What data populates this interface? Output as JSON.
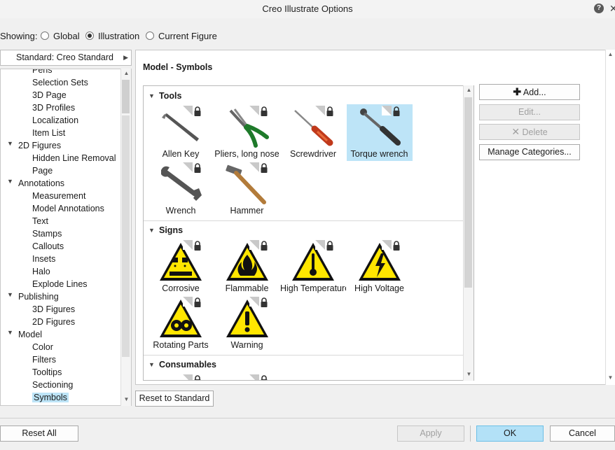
{
  "window": {
    "title": "Creo Illustrate Options"
  },
  "showing": {
    "label": "Showing:",
    "options": [
      {
        "label": "Global",
        "checked": false
      },
      {
        "label": "Illustration",
        "checked": true
      },
      {
        "label": "Current Figure",
        "checked": false
      }
    ]
  },
  "left_panel": {
    "dropdown": "Standard: Creo Standard",
    "tree": [
      {
        "label": "Pens",
        "level": 1
      },
      {
        "label": "Selection Sets",
        "level": 1
      },
      {
        "label": "3D Page",
        "level": 1
      },
      {
        "label": "3D Profiles",
        "level": 1
      },
      {
        "label": "Localization",
        "level": 1
      },
      {
        "label": "Item List",
        "level": 1
      },
      {
        "label": "2D Figures",
        "level": 0
      },
      {
        "label": "Hidden Line Removal",
        "level": 1
      },
      {
        "label": "Page",
        "level": 1
      },
      {
        "label": "Annotations",
        "level": 0
      },
      {
        "label": "Measurement",
        "level": 1
      },
      {
        "label": "Model Annotations",
        "level": 1
      },
      {
        "label": "Text",
        "level": 1
      },
      {
        "label": "Stamps",
        "level": 1
      },
      {
        "label": "Callouts",
        "level": 1
      },
      {
        "label": "Insets",
        "level": 1
      },
      {
        "label": "Halo",
        "level": 1
      },
      {
        "label": "Explode Lines",
        "level": 1
      },
      {
        "label": "Publishing",
        "level": 0
      },
      {
        "label": "3D Figures",
        "level": 1
      },
      {
        "label": "2D Figures",
        "level": 1
      },
      {
        "label": "Model",
        "level": 0
      },
      {
        "label": "Color",
        "level": 1
      },
      {
        "label": "Filters",
        "level": 1
      },
      {
        "label": "Tooltips",
        "level": 1
      },
      {
        "label": "Sectioning",
        "level": 1
      },
      {
        "label": "Symbols",
        "level": 1,
        "selected": true
      }
    ]
  },
  "main": {
    "title": "Model - Symbols",
    "categories": [
      {
        "name": "Tools",
        "items": [
          {
            "label": "Allen Key",
            "icon": "allen-key"
          },
          {
            "label": "Pliers, long nose",
            "icon": "pliers"
          },
          {
            "label": "Screwdriver",
            "icon": "screwdriver"
          },
          {
            "label": "Torque wrench",
            "icon": "torque-wrench",
            "selected": true
          },
          {
            "label": "Wrench",
            "icon": "wrench"
          },
          {
            "label": "Hammer",
            "icon": "hammer"
          }
        ]
      },
      {
        "name": "Signs",
        "items": [
          {
            "label": "Corrosive",
            "icon": "corrosive-sign"
          },
          {
            "label": "Flammable",
            "icon": "flammable-sign"
          },
          {
            "label": "High Temperature",
            "icon": "high-temperature-sign"
          },
          {
            "label": "High Voltage",
            "icon": "high-voltage-sign"
          },
          {
            "label": "Rotating Parts",
            "icon": "rotating-parts-sign"
          },
          {
            "label": "Warning",
            "icon": "warning-sign"
          }
        ]
      },
      {
        "name": "Consumables",
        "items": []
      }
    ],
    "buttons": {
      "add": "Add...",
      "edit": "Edit...",
      "delete": "Delete",
      "manage": "Manage Categories..."
    },
    "reset_standard": "Reset to Standard"
  },
  "footer": {
    "reset_all": "Reset All",
    "apply": "Apply",
    "ok": "OK",
    "cancel": "Cancel"
  },
  "colors": {
    "selection": "#bde4f7",
    "primary_button": "#b3e1f7",
    "sign_yellow": "#ffe600"
  }
}
